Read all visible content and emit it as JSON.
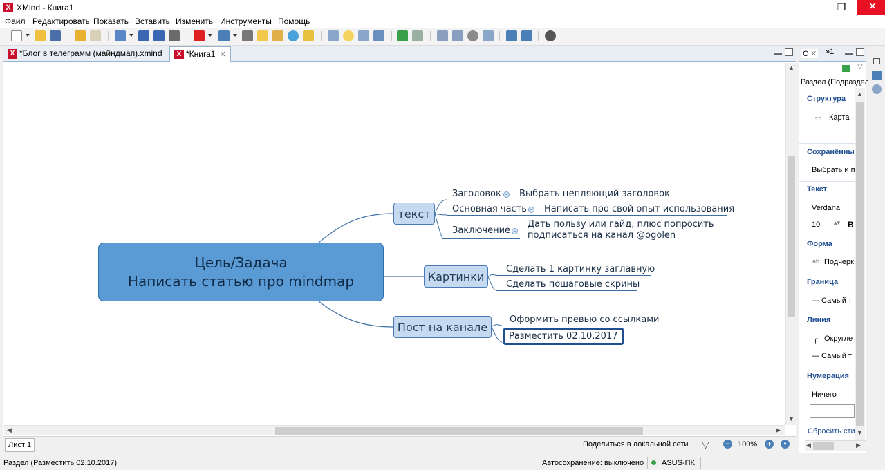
{
  "window": {
    "title": "XMind - Книга1",
    "app_icon": "xmind-icon"
  },
  "menu": [
    "Файл",
    "Редактировать",
    "Показать",
    "Вставить",
    "Изменить",
    "Инструменты",
    "Помощь"
  ],
  "tabs": [
    {
      "label": "*Блог в телеграмм (майндмап).xmind",
      "active": false
    },
    {
      "label": "*Книга1",
      "active": true
    }
  ],
  "mindmap": {
    "central": {
      "line1": "Цель/Задача",
      "line2": "Написать статью про mindmap"
    },
    "topics": [
      {
        "label": "текст",
        "children": [
          {
            "label": "Заголовок",
            "child": "Выбрать цепляющий заголовок"
          },
          {
            "label": "Основная часть",
            "child": "Написать про свой опыт использования"
          },
          {
            "label": "Заключение",
            "child_line1": "Дать пользу или гайд, плюс попросить",
            "child_line2": "подписаться на канал @ogolen"
          }
        ]
      },
      {
        "label": "Картинки",
        "children": [
          {
            "label": "Сделать 1 картинку заглавную"
          },
          {
            "label": "Сделать пошаговые скрины"
          }
        ]
      },
      {
        "label": "Пост на канале",
        "children": [
          {
            "label": "Оформить превью со ссылками"
          },
          {
            "label": "Разместить 02.10.2017",
            "selected": true
          }
        ]
      }
    ]
  },
  "editor_status": {
    "sheet": "Лист 1",
    "share": "Поделиться в локальной сети",
    "zoom": "100%"
  },
  "right_panel": {
    "tab1": "С",
    "tab2": "1",
    "header": "Раздел (Подраздел",
    "sections": [
      {
        "title": "Структура",
        "item": "Карта"
      },
      {
        "title": "Сохранённы",
        "item": "Выбрать и п"
      },
      {
        "title": "Текст",
        "item": "Verdana",
        "item2": "10"
      },
      {
        "title": "Форма",
        "item": "Подчерк"
      },
      {
        "title": "Граница",
        "item": "— Самый т"
      },
      {
        "title": "Линия",
        "item": "Округле",
        "item2": "— Самый т"
      },
      {
        "title": "Нумерация",
        "item": "Ничего"
      }
    ],
    "reset": "Сбросить сти"
  },
  "status_bar": {
    "selection": "Раздел (Разместить 02.10.2017)",
    "autosave": "Автосохранение: выключено",
    "user": "ASUS-ПК"
  },
  "colors": {
    "central_fill": "#5b9bd5",
    "topic_fill": "#c5d9f1",
    "line": "#3d6fa5",
    "close": "#e81123"
  }
}
